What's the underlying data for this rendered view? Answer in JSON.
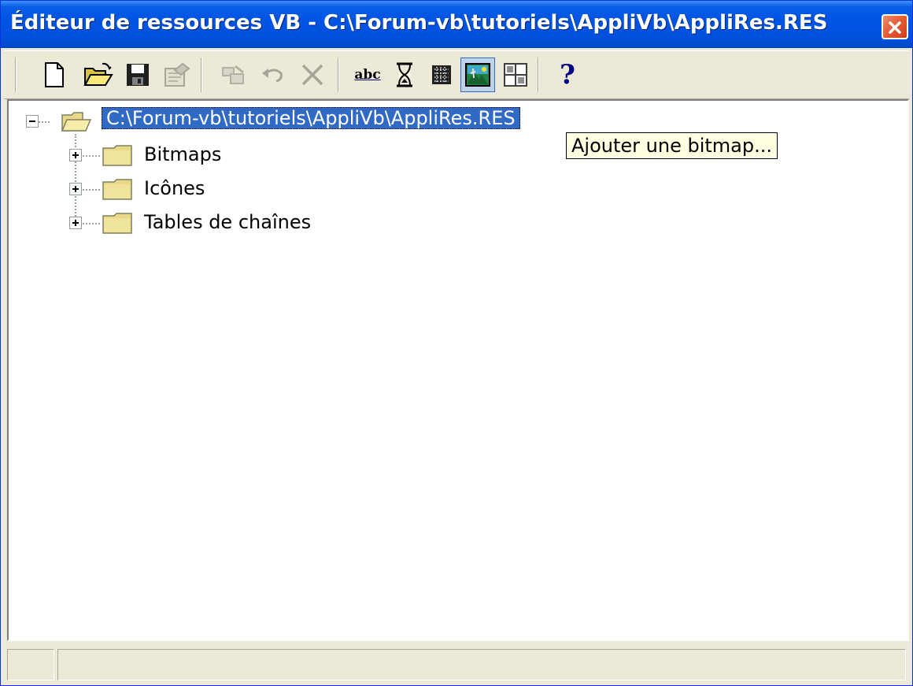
{
  "window": {
    "title": "Éditeur de ressources VB - C:\\Forum-vb\\tutoriels\\AppliVb\\AppliRes.RES"
  },
  "toolbar": {
    "buttons": [
      {
        "name": "new",
        "icon": "new-document-icon",
        "enabled": true
      },
      {
        "name": "open",
        "icon": "open-folder-icon",
        "enabled": true
      },
      {
        "name": "save",
        "icon": "save-disk-icon",
        "enabled": true
      },
      {
        "name": "properties",
        "icon": "properties-icon",
        "enabled": false
      },
      {
        "name": "edit-resource",
        "icon": "edit-resource-icon",
        "enabled": false
      },
      {
        "name": "undo",
        "icon": "undo-icon",
        "enabled": false
      },
      {
        "name": "delete",
        "icon": "delete-icon",
        "enabled": false
      },
      {
        "name": "string-table",
        "icon": "string-table-icon",
        "label": "abc",
        "enabled": true
      },
      {
        "name": "add-cursor",
        "icon": "cursor-icon",
        "enabled": true
      },
      {
        "name": "add-icon",
        "icon": "icon-resource-icon",
        "enabled": true
      },
      {
        "name": "add-bitmap",
        "icon": "bitmap-icon",
        "enabled": true,
        "pressed": true
      },
      {
        "name": "add-custom",
        "icon": "custom-resource-icon",
        "enabled": true
      },
      {
        "name": "help",
        "icon": "help-icon",
        "label": "?",
        "enabled": true
      }
    ],
    "tooltip": "Ajouter une bitmap..."
  },
  "tree": {
    "root": {
      "label": "C:\\Forum-vb\\tutoriels\\AppliVb\\AppliRes.RES",
      "expanded": true,
      "selected": true
    },
    "children": [
      {
        "label": "Bitmaps"
      },
      {
        "label": "Icônes"
      },
      {
        "label": "Tables de chaînes"
      }
    ]
  },
  "colors": {
    "titlebar": "#0054e3",
    "selection": "#316ac5",
    "tooltip_bg": "#ffffe1",
    "window_bg": "#ece9d8"
  }
}
